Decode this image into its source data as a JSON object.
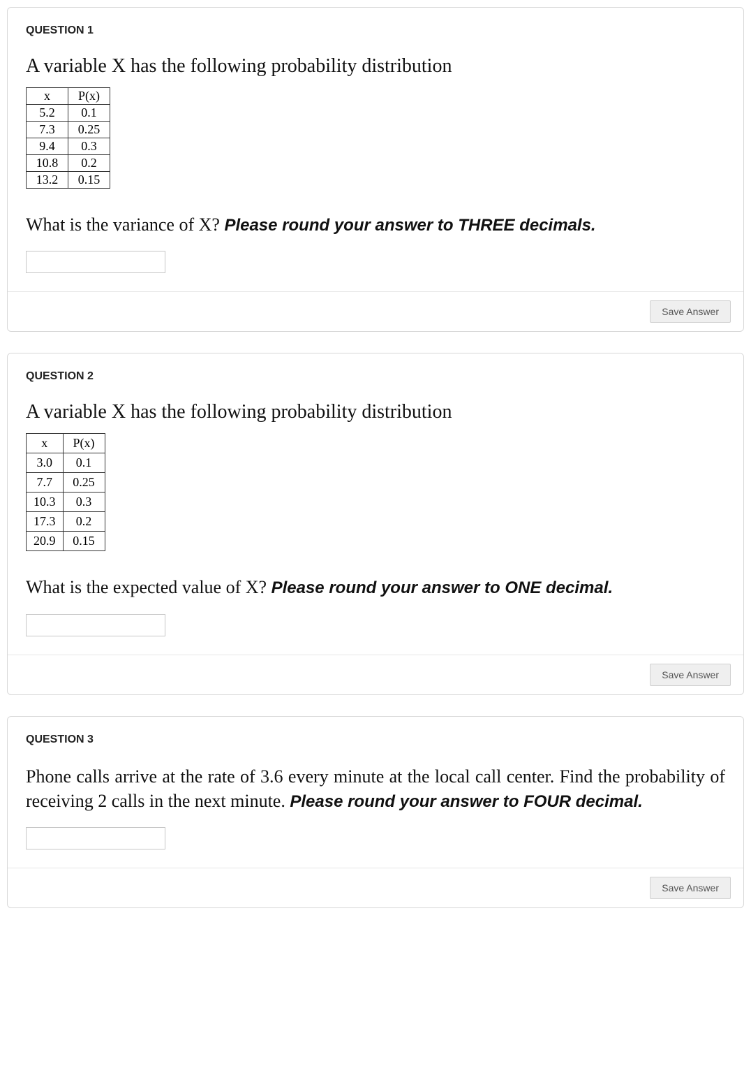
{
  "questions": [
    {
      "label": "QUESTION 1",
      "title": "A variable X has the following probability distribution",
      "table": {
        "headers": [
          "x",
          "P(x)"
        ],
        "rows": [
          [
            "5.2",
            "0.1"
          ],
          [
            "7.3",
            "0.25"
          ],
          [
            "9.4",
            "0.3"
          ],
          [
            "10.8",
            "0.2"
          ],
          [
            "13.2",
            "0.15"
          ]
        ]
      },
      "prompt_plain": "What is the variance of X? ",
      "prompt_bold": "Please round your answer to THREE decimals.",
      "save_label": "Save Answer"
    },
    {
      "label": "QUESTION 2",
      "title": "A variable X has the following probability distribution",
      "table": {
        "headers": [
          "x",
          "P(x)"
        ],
        "rows": [
          [
            "3.0",
            "0.1"
          ],
          [
            "7.7",
            "0.25"
          ],
          [
            "10.3",
            "0.3"
          ],
          [
            "17.3",
            "0.2"
          ],
          [
            "20.9",
            "0.15"
          ]
        ]
      },
      "prompt_plain": "What is the expected value of X? ",
      "prompt_bold": "Please round your answer to ONE decimal.",
      "save_label": "Save Answer"
    },
    {
      "label": "QUESTION 3",
      "prompt_plain": "Phone calls arrive at the rate of 3.6 every minute at the local call center. Find the probability of receiving 2 calls in the next minute. ",
      "prompt_bold": "Please round your answer to FOUR decimal.",
      "save_label": "Save Answer"
    }
  ]
}
